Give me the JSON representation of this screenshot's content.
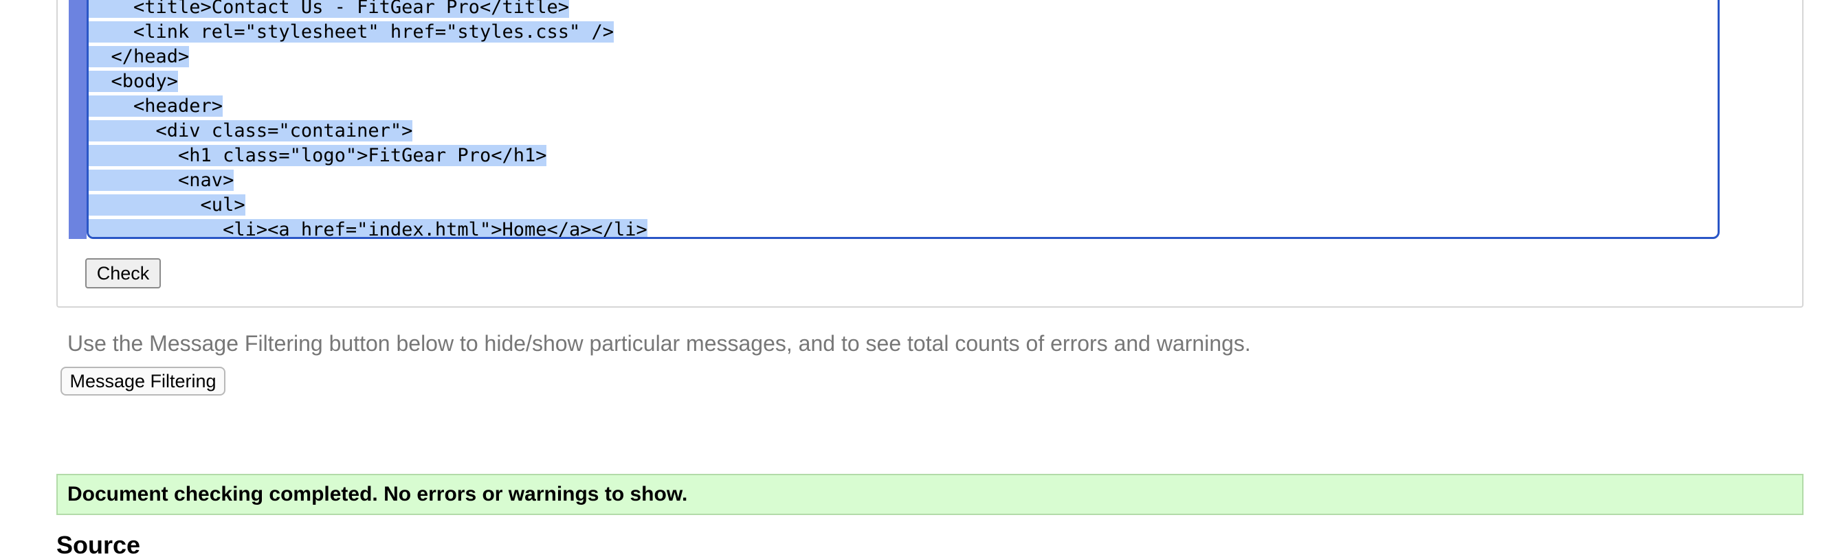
{
  "editor": {
    "lines": [
      {
        "text": "    <title>Contact Us - FitGear Pro</title>"
      },
      {
        "text": "    <link rel=\"stylesheet\" href=\"styles.css\" />"
      },
      {
        "text": "  </head>"
      },
      {
        "text": "  <body>"
      },
      {
        "text": "    <header>"
      },
      {
        "text": "      <div class=\"container\">"
      },
      {
        "text": "        <h1 class=\"logo\">FitGear Pro</h1>"
      },
      {
        "text": "        <nav>"
      },
      {
        "text": "          <ul>"
      },
      {
        "text": "            <li><a href=\"index.html\">Home</a></li>"
      }
    ],
    "selection_color": "#b8d3fa",
    "gutter_color": "#6c83e0"
  },
  "check_button": "Check",
  "filter_hint": "Use the Message Filtering button below to hide/show particular messages, and to see total counts of errors and warnings.",
  "filter_button": "Message Filtering",
  "status_message": "Document checking completed. No errors or warnings to show.",
  "source_heading": "Source",
  "icons": {
    "grammarly_suggestion": "lightbulb-icon",
    "grammarly_logo": "grammarly-icon"
  },
  "colors": {
    "success_bg": "#d8fcd1",
    "editor_border": "#2a56c6"
  }
}
